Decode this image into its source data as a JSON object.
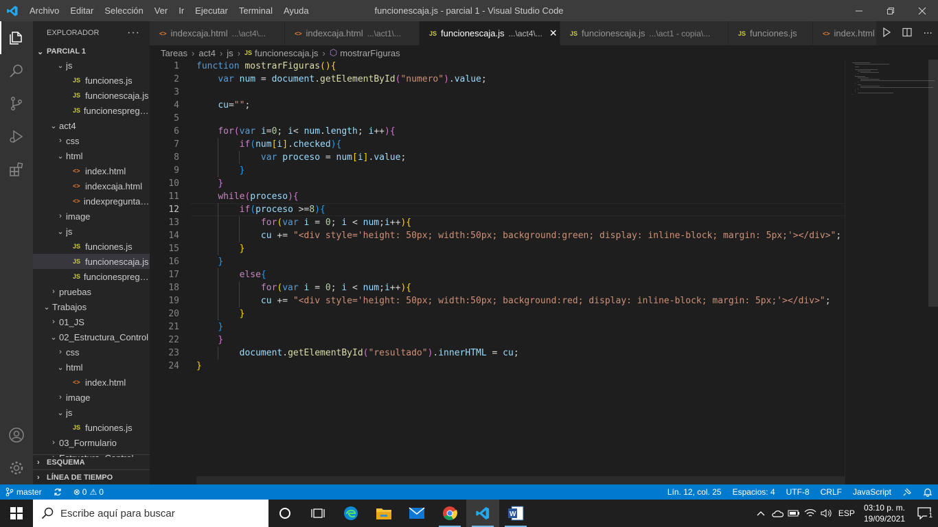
{
  "window": {
    "title": "funcionescaja.js - parcial 1 - Visual Studio Code",
    "menu": [
      "Archivo",
      "Editar",
      "Selección",
      "Ver",
      "Ir",
      "Ejecutar",
      "Terminal",
      "Ayuda"
    ]
  },
  "sidebar": {
    "header": "EXPLORADOR",
    "root": "PARCIAL 1",
    "tree": [
      {
        "label": "js",
        "depth": 2,
        "kind": "folder",
        "open": true
      },
      {
        "label": "funciones.js",
        "depth": 3,
        "kind": "js"
      },
      {
        "label": "funcionescaja.js",
        "depth": 3,
        "kind": "js"
      },
      {
        "label": "funcionespregunt...",
        "depth": 3,
        "kind": "js"
      },
      {
        "label": "act4",
        "depth": 1,
        "kind": "folder",
        "open": true
      },
      {
        "label": "css",
        "depth": 2,
        "kind": "folder",
        "open": false
      },
      {
        "label": "html",
        "depth": 2,
        "kind": "folder",
        "open": true
      },
      {
        "label": "index.html",
        "depth": 3,
        "kind": "html"
      },
      {
        "label": "indexcaja.html",
        "depth": 3,
        "kind": "html"
      },
      {
        "label": "indexpreguntas.h...",
        "depth": 3,
        "kind": "html"
      },
      {
        "label": "image",
        "depth": 2,
        "kind": "folder",
        "open": false
      },
      {
        "label": "js",
        "depth": 2,
        "kind": "folder",
        "open": true
      },
      {
        "label": "funciones.js",
        "depth": 3,
        "kind": "js"
      },
      {
        "label": "funcionescaja.js",
        "depth": 3,
        "kind": "js",
        "selected": true
      },
      {
        "label": "funcionespregunt...",
        "depth": 3,
        "kind": "js"
      },
      {
        "label": "pruebas",
        "depth": 1,
        "kind": "folder",
        "open": false
      },
      {
        "label": "Trabajos",
        "depth": 0,
        "kind": "folder",
        "open": true
      },
      {
        "label": "01_JS",
        "depth": 1,
        "kind": "folder",
        "open": false
      },
      {
        "label": "02_Estructura_Control",
        "depth": 1,
        "kind": "folder",
        "open": true
      },
      {
        "label": "css",
        "depth": 2,
        "kind": "folder",
        "open": false
      },
      {
        "label": "html",
        "depth": 2,
        "kind": "folder",
        "open": true
      },
      {
        "label": "index.html",
        "depth": 3,
        "kind": "html"
      },
      {
        "label": "image",
        "depth": 2,
        "kind": "folder",
        "open": false
      },
      {
        "label": "js",
        "depth": 2,
        "kind": "folder",
        "open": true
      },
      {
        "label": "funciones.js",
        "depth": 3,
        "kind": "js"
      },
      {
        "label": "03_Formulario",
        "depth": 1,
        "kind": "folder",
        "open": false
      },
      {
        "label": "Estructura_Control",
        "depth": 1,
        "kind": "folder",
        "open": false
      }
    ],
    "outline": "ESQUEMA",
    "timeline": "LÍNEA DE TIEMPO"
  },
  "tabs": [
    {
      "icon": "<>",
      "name": "indexcaja.html",
      "desc": "...\\act4\\...",
      "active": false
    },
    {
      "icon": "<>",
      "name": "indexcaja.html",
      "desc": "...\\act1\\...",
      "active": false
    },
    {
      "icon": "JS",
      "name": "funcionescaja.js",
      "desc": "...\\act4\\...",
      "active": true
    },
    {
      "icon": "JS",
      "name": "funcionescaja.js",
      "desc": "...\\act1 - copia\\...",
      "active": false
    },
    {
      "icon": "JS",
      "name": "funciones.js",
      "desc": "",
      "active": false
    },
    {
      "icon": "<>",
      "name": "index.html",
      "desc": "",
      "active": false
    }
  ],
  "breadcrumb": [
    "Tareas",
    "act4",
    "js",
    "funcionescaja.js",
    "mostrarFiguras"
  ],
  "editor": {
    "current_line": 12,
    "lines": [
      "function mostrarFiguras(){",
      "    var num = document.getElementById(\"numero\").value;",
      "",
      "    cu=\"\";",
      "",
      "    for(var i=0; i< num.length; i++){",
      "        if(num[i].checked){",
      "            var proceso = num[i].value;",
      "        }",
      "    }",
      "    while(proceso){",
      "        if(proceso >=8){",
      "            for(var i = 0; i < num;i++){",
      "            cu += \"<div style='height: 50px; width:50px; background:green; display: inline-block; margin: 5px;'></div>\";",
      "        }",
      "    }",
      "        else{",
      "            for(var i = 0; i < num;i++){",
      "            cu += \"<div style='height: 50px; width:50px; background:red; display: inline-block; margin: 5px;'></div>\";",
      "        }",
      "    }",
      "    }",
      "        document.getElementById(\"resultado\").innerHTML = cu;",
      "}"
    ]
  },
  "statusbar": {
    "branch": "master",
    "errors": "0",
    "warnings": "0",
    "position": "Lín. 12, col. 25",
    "spaces": "Espacios: 4",
    "encoding": "UTF-8",
    "eol": "CRLF",
    "language": "JavaScript"
  },
  "taskbar": {
    "search_placeholder": "Escribe aquí para buscar",
    "lang": "ESP",
    "time": "03:10 p. m.",
    "date": "19/09/2021",
    "notifications": "1"
  },
  "colors": {
    "accent": "#007acc",
    "keyword": "#569cd6",
    "control": "#c586c0",
    "function": "#dcdcaa",
    "string": "#ce9178",
    "variable": "#9cdcfe",
    "number": "#b5cea8",
    "js_icon": "#cbcb41",
    "html_icon": "#e37933"
  }
}
